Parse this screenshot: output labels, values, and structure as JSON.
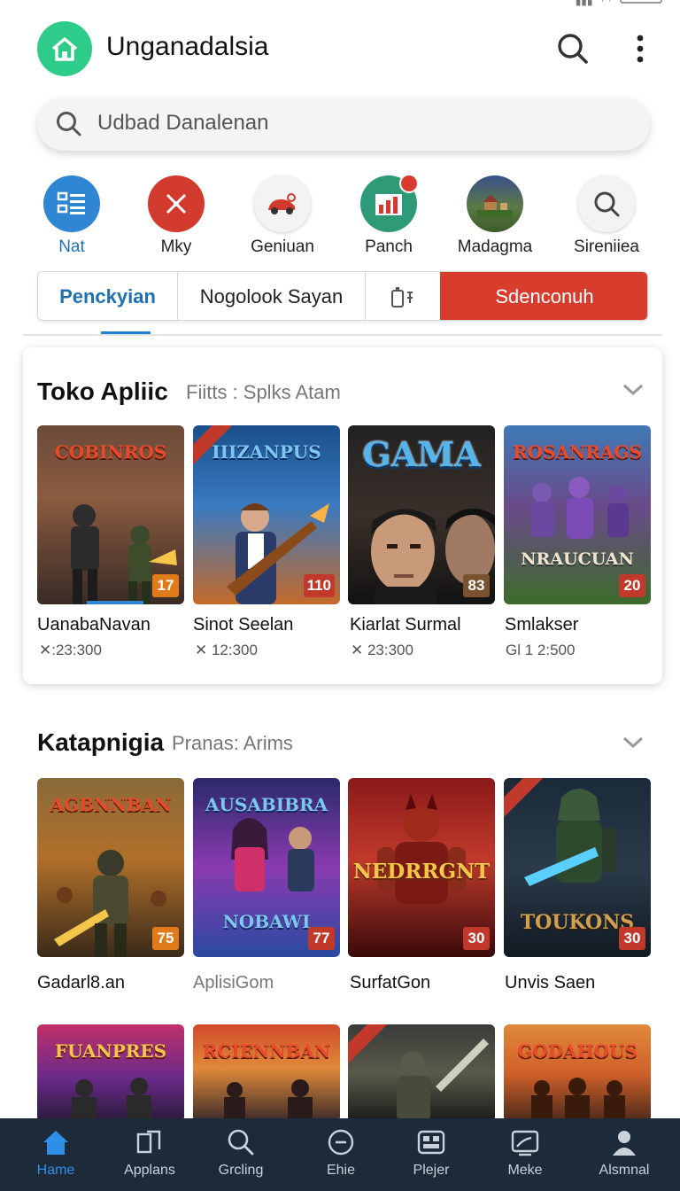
{
  "app": {
    "title": "Unganadalsia"
  },
  "search": {
    "placeholder": "Udbad Danalenan"
  },
  "categories": [
    {
      "label": "Nat",
      "icon": "list-icon",
      "color": "#2f86d3"
    },
    {
      "label": "Mky",
      "icon": "tools-icon",
      "color": "#d23a2d"
    },
    {
      "label": "Geniuan",
      "icon": "car-icon",
      "color": "#f3f3f3"
    },
    {
      "label": "Panch",
      "icon": "chart-icon",
      "color": "#2e9a78"
    },
    {
      "label": "Madagma",
      "icon": "landscape-icon",
      "color": "#3b6e3a"
    },
    {
      "label": "Sireniiea",
      "icon": "search-icon",
      "color": "#f3f3f3"
    }
  ],
  "tabs": [
    {
      "label": "Penckyian",
      "active": true
    },
    {
      "label": "Nogolook Sayan"
    },
    {
      "label": "",
      "icon": "device-icon"
    },
    {
      "label": "Sdenconuh",
      "highlight": true
    }
  ],
  "section1": {
    "title": "Toko Apliic",
    "subtitle": "Fiitts : Splks Atam",
    "items": [
      {
        "logo": "COBINROS",
        "name": "UanabaNavan",
        "stat": "✕:23:300",
        "badge": "17",
        "badge_color": "#e07b1c"
      },
      {
        "logo": "IIIZANPUS",
        "name": "Sinot Seelan",
        "stat": "✕ 12:300",
        "badge": "110",
        "badge_color": "#c0392b"
      },
      {
        "logo": "GAMA",
        "name": "Kiarlat Surmal",
        "stat": "✕ 23:300",
        "badge": "83",
        "badge_color": "#7a5230"
      },
      {
        "logo": "ROSANRAGS",
        "sub_logo": "NRAUCUAN",
        "name": "Smlakser",
        "stat": "Gl 1 2:500",
        "badge": "20",
        "badge_color": "#c0392b"
      }
    ]
  },
  "section2": {
    "title": "Katapnigia",
    "subtitle": "Pranas: Arims",
    "items": [
      {
        "logo": "AGBNNBAN",
        "name": "Gadarl8.an",
        "badge": "75",
        "badge_color": "#e07b1c"
      },
      {
        "logo": "AUSABIBRA",
        "sub_logo": "NOBAWI",
        "name": "AplisiGom",
        "badge": "77",
        "badge_color": "#c0392b"
      },
      {
        "logo": "NEDRRGNT",
        "name": "SurfatGon",
        "badge": "30",
        "badge_color": "#c0392b"
      },
      {
        "logo": "TOUKONS",
        "name": "Unvis Saen",
        "badge": "30",
        "badge_color": "#c0392b"
      }
    ]
  },
  "section3": {
    "items": [
      {
        "logo": "FUANPRES"
      },
      {
        "logo": "RCIENNBAN"
      },
      {
        "logo": ""
      },
      {
        "logo": "GODAHOUS"
      }
    ]
  },
  "bottom_nav": [
    {
      "label": "Hame",
      "icon": "home-icon",
      "active": true
    },
    {
      "label": "Applans",
      "icon": "apps-icon"
    },
    {
      "label": "Grcling",
      "icon": "search-icon"
    },
    {
      "label": "Ehie",
      "icon": "circle-minus-icon"
    },
    {
      "label": "Plejer",
      "icon": "player-icon"
    },
    {
      "label": "Meke",
      "icon": "cast-icon"
    },
    {
      "label": "Alsmnal",
      "icon": "user-icon"
    }
  ]
}
